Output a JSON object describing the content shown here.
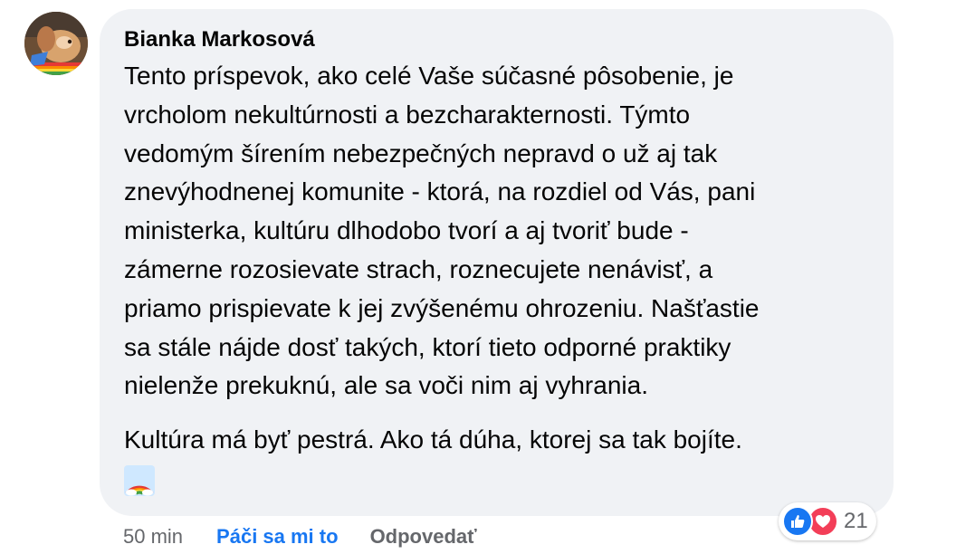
{
  "comment": {
    "author": "Bianka Markosová",
    "lines": [
      "Tento príspevok, ako celé Vaše súčasné pôsobenie, je",
      "vrcholom nekultúrnosti a bezcharakternosti. Týmto",
      "vedomým šírením nebezpečných nepravd o už aj tak",
      "znevýhodnenej komunite - ktorá, na rozdiel od Vás, pani",
      "ministerka, kultúru dlhodobo tvorí a aj tvoriť bude -",
      "zámerne rozosievate strach, roznecujete nenávisť, a",
      "priamo prispievate k jej zvýšenému ohrozeniu. Našťastie",
      "sa stále nájde dosť takých, ktorí tieto odporné praktiky",
      "nielenže prekuknú, ale sa voči nim aj vyhrania."
    ],
    "second_paragraph": "Kultúra má byť pestrá. Ako tá dúha, ktorej sa tak bojíte.",
    "emoji": "rainbow-emoji",
    "timestamp": "50 min",
    "like_label": "Páči sa mi to",
    "reply_label": "Odpovedať",
    "reactions": {
      "icons": [
        "like-icon",
        "love-icon"
      ],
      "count": "21"
    }
  },
  "colors": {
    "bubble_bg": "#f0f2f5",
    "like_blue": "#1877f2",
    "love_red": "#f33e58",
    "secondary_text": "#65676b"
  }
}
